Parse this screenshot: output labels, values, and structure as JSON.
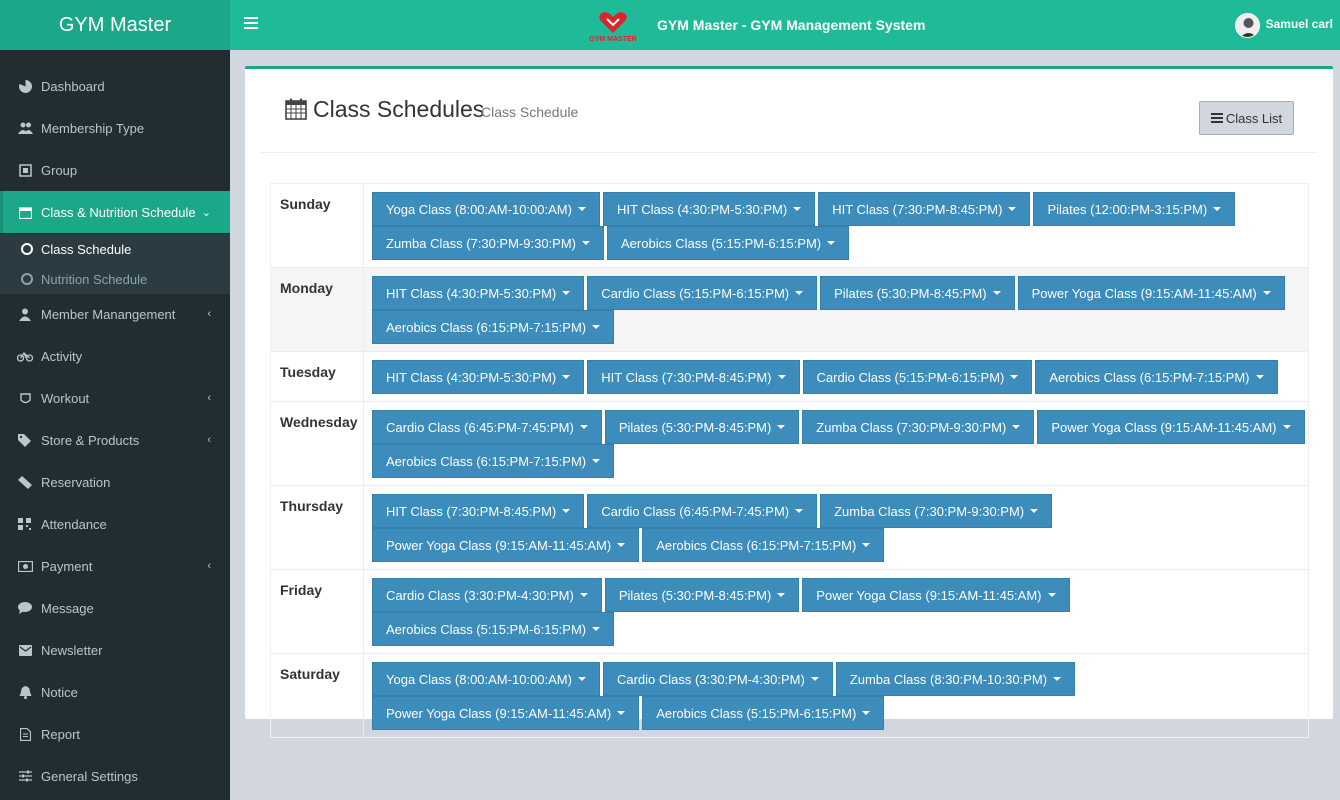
{
  "header": {
    "brand": "GYM Master",
    "title": "GYM Master - GYM Management System",
    "logo_text": "GYM MASTER",
    "user_name": "Samuel carl"
  },
  "sidebar": {
    "items": [
      {
        "label": "Dashboard",
        "icon": "dashboard-icon"
      },
      {
        "label": "Membership Type",
        "icon": "users-icon"
      },
      {
        "label": "Group",
        "icon": "group-icon"
      },
      {
        "label": "Class & Nutrition Schedule",
        "icon": "calendar-icon"
      },
      {
        "label": "Member Manangement",
        "icon": "user-icon"
      },
      {
        "label": "Activity",
        "icon": "bicycle-icon"
      },
      {
        "label": "Workout",
        "icon": "workout-icon"
      },
      {
        "label": "Store & Products",
        "icon": "tags-icon"
      },
      {
        "label": "Reservation",
        "icon": "ticket-icon"
      },
      {
        "label": "Attendance",
        "icon": "qrcode-icon"
      },
      {
        "label": "Payment",
        "icon": "money-icon"
      },
      {
        "label": "Message",
        "icon": "comment-icon"
      },
      {
        "label": "Newsletter",
        "icon": "envelope-icon"
      },
      {
        "label": "Notice",
        "icon": "bell-icon"
      },
      {
        "label": "Report",
        "icon": "file-icon"
      },
      {
        "label": "General Settings",
        "icon": "sliders-icon"
      }
    ],
    "submenu": [
      {
        "label": "Class Schedule"
      },
      {
        "label": "Nutrition Schedule"
      }
    ]
  },
  "page": {
    "title": "Class Schedules",
    "subtitle": "Class Schedule",
    "class_list_button": "Class List"
  },
  "schedule": [
    {
      "day": "Sunday",
      "classes": [
        "Yoga Class (8:00:AM-10:00:AM)",
        "HIT Class (4:30:PM-5:30:PM)",
        "HIT Class (7:30:PM-8:45:PM)",
        "Pilates (12:00:PM-3:15:PM)",
        "Zumba Class (7:30:PM-9:30:PM)",
        "Aerobics Class (5:15:PM-6:15:PM)"
      ]
    },
    {
      "day": "Monday",
      "classes": [
        "HIT Class (4:30:PM-5:30:PM)",
        "Cardio Class (5:15:PM-6:15:PM)",
        "Pilates (5:30:PM-8:45:PM)",
        "Power Yoga Class (9:15:AM-11:45:AM)",
        "Aerobics Class (6:15:PM-7:15:PM)"
      ]
    },
    {
      "day": "Tuesday",
      "classes": [
        "HIT Class (4:30:PM-5:30:PM)",
        "HIT Class (7:30:PM-8:45:PM)",
        "Cardio Class (5:15:PM-6:15:PM)",
        "Aerobics Class (6:15:PM-7:15:PM)"
      ]
    },
    {
      "day": "Wednesday",
      "classes": [
        "Cardio Class (6:45:PM-7:45:PM)",
        "Pilates (5:30:PM-8:45:PM)",
        "Zumba Class (7:30:PM-9:30:PM)",
        "Power Yoga Class (9:15:AM-11:45:AM)",
        "Aerobics Class (6:15:PM-7:15:PM)"
      ]
    },
    {
      "day": "Thursday",
      "classes": [
        "HIT Class (7:30:PM-8:45:PM)",
        "Cardio Class (6:45:PM-7:45:PM)",
        "Zumba Class (7:30:PM-9:30:PM)",
        "Power Yoga Class (9:15:AM-11:45:AM)",
        "Aerobics Class (6:15:PM-7:15:PM)"
      ]
    },
    {
      "day": "Friday",
      "classes": [
        "Cardio Class (3:30:PM-4:30:PM)",
        "Pilates (5:30:PM-8:45:PM)",
        "Power Yoga Class (9:15:AM-11:45:AM)",
        "Aerobics Class (5:15:PM-6:15:PM)"
      ]
    },
    {
      "day": "Saturday",
      "classes": [
        "Yoga Class (8:00:AM-10:00:AM)",
        "Cardio Class (3:30:PM-4:30:PM)",
        "Zumba Class (8:30:PM-10:30:PM)",
        "Power Yoga Class (9:15:AM-11:45:AM)",
        "Aerobics Class (5:15:PM-6:15:PM)"
      ]
    }
  ],
  "colors": {
    "brand": "#1aa888",
    "topbar": "#1fbb99",
    "sidebar": "#222d32",
    "class_button": "#3c8dbc"
  }
}
